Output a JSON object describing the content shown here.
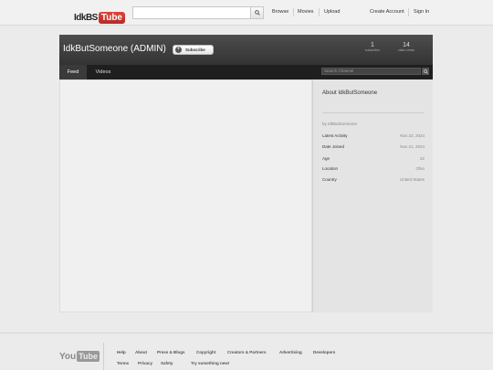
{
  "masthead": {
    "logo_left": "IdkBS",
    "logo_right": "Tube",
    "search_placeholder": "",
    "nav": [
      "Browse",
      "Movies",
      "Upload"
    ],
    "account": [
      "Create Account",
      "Sign In"
    ]
  },
  "channel": {
    "title": "IdkButSomeone (ADMIN)",
    "subscribe_label": "Subscribe",
    "stats": [
      {
        "num": "1",
        "label": "subscriber"
      },
      {
        "num": "14",
        "label": "video views"
      }
    ],
    "tabs": [
      "Feed",
      "Videos"
    ],
    "search_placeholder": "Search Channel"
  },
  "about": {
    "title": "About IdkButSomeone",
    "by": "by IdkButSomeone",
    "rows": [
      {
        "label": "Latest Activity",
        "value": "Nov 22, 2024"
      },
      {
        "label": "Date Joined",
        "value": "Nov 21, 2024"
      },
      {
        "label": "Age",
        "value": "22"
      },
      {
        "label": "Location",
        "value": "Ohio"
      },
      {
        "label": "Country",
        "value": "United States"
      }
    ]
  },
  "footer": {
    "logo_left": "You",
    "logo_right": "Tube",
    "row1": [
      "Help",
      "About",
      "Press & Blogs",
      "Copyright",
      "Creators & Partners",
      "Advertising",
      "Developers"
    ],
    "row2": [
      "Terms",
      "Privacy",
      "Safety",
      "Try something new!"
    ]
  }
}
